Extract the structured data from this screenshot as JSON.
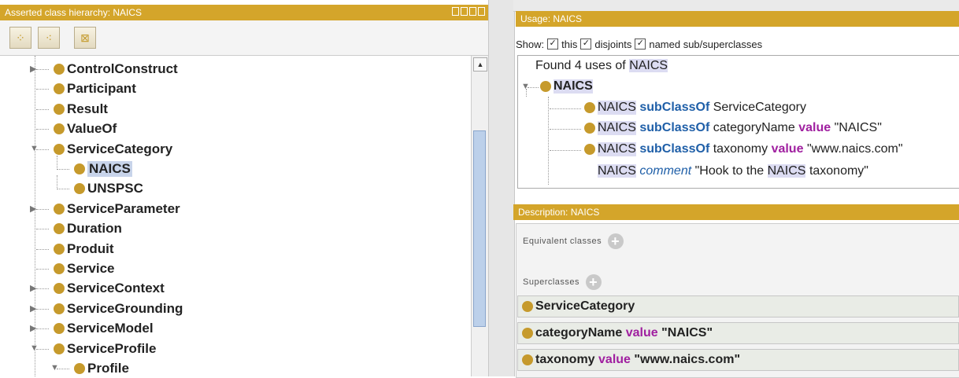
{
  "left": {
    "title": "Asserted class hierarchy: NAICS",
    "toolbar": [
      "add-subclass-icon",
      "add-sibling-icon",
      "delete-class-icon"
    ],
    "tree": [
      {
        "label": "ControlConstruct",
        "expand": "collapsed"
      },
      {
        "label": "Participant",
        "expand": "none"
      },
      {
        "label": "Result",
        "expand": "none"
      },
      {
        "label": "ValueOf",
        "expand": "none"
      },
      {
        "label": "ServiceCategory",
        "expand": "expanded"
      },
      {
        "label": "NAICS",
        "expand": "none",
        "selected": true
      },
      {
        "label": "UNSPSC",
        "expand": "none"
      },
      {
        "label": "ServiceParameter",
        "expand": "collapsed"
      },
      {
        "label": "Duration",
        "expand": "none"
      },
      {
        "label": "Produit",
        "expand": "none"
      },
      {
        "label": "Service",
        "expand": "none"
      },
      {
        "label": "ServiceContext",
        "expand": "collapsed"
      },
      {
        "label": "ServiceGrounding",
        "expand": "collapsed"
      },
      {
        "label": "ServiceModel",
        "expand": "collapsed"
      },
      {
        "label": "ServiceProfile",
        "expand": "expanded"
      },
      {
        "label": "Profile",
        "expand": "expanded"
      }
    ]
  },
  "usage": {
    "title": "Usage: NAICS",
    "show_label": "Show:",
    "options": [
      {
        "label": "this",
        "checked": true
      },
      {
        "label": "disjoints",
        "checked": true
      },
      {
        "label": "named sub/superclasses",
        "checked": true
      }
    ],
    "found_prefix": "Found 4 uses of",
    "found_term": "NAICS",
    "root": "NAICS",
    "axioms": [
      {
        "subject": "NAICS",
        "kw": "subClassOf",
        "rest": "ServiceCategory",
        "value_kw": "",
        "value": ""
      },
      {
        "subject": "NAICS",
        "kw": "subClassOf",
        "rest": "categoryName",
        "value_kw": "value",
        "value": "\"NAICS\""
      },
      {
        "subject": "NAICS",
        "kw": "subClassOf",
        "rest": "taxonomy",
        "value_kw": "value",
        "value": "\"www.naics.com\""
      }
    ],
    "comment": {
      "subject": "NAICS",
      "kw": "comment",
      "text1": "\"Hook to the",
      "term": "NAICS",
      "text2": "taxonomy\""
    }
  },
  "description": {
    "title": "Description: NAICS",
    "equivalent_label": "Equivalent classes",
    "super_label": "Superclasses",
    "superclasses": [
      {
        "name": "ServiceCategory",
        "kw": "",
        "value": ""
      },
      {
        "name": "categoryName",
        "kw": "value",
        "value": "\"NAICS\""
      },
      {
        "name": "taxonomy",
        "kw": "value",
        "value": "\"www.naics.com\""
      }
    ]
  }
}
